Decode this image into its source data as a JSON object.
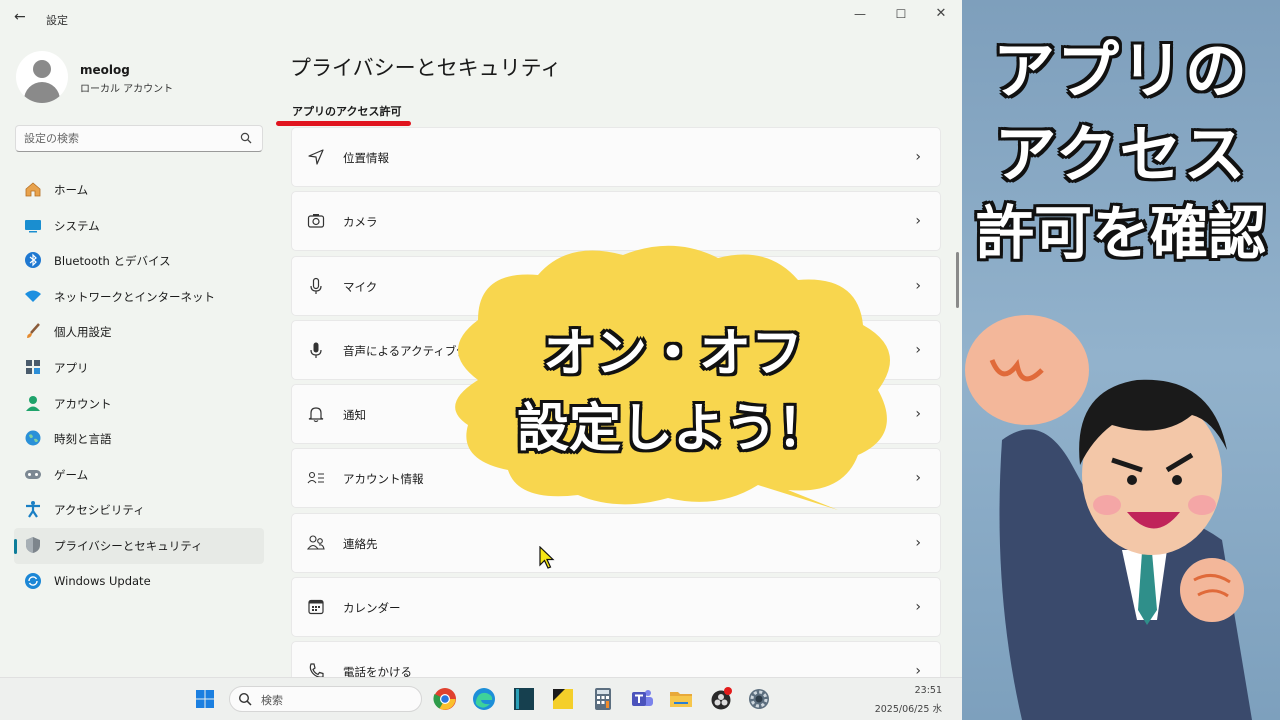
{
  "window": {
    "title": "設定"
  },
  "profile": {
    "name": "meolog",
    "account_type": "ローカル アカウント"
  },
  "search": {
    "placeholder": "設定の検索"
  },
  "sidebar": {
    "items": [
      {
        "label": "ホーム",
        "icon": "home-icon"
      },
      {
        "label": "システム",
        "icon": "system-icon"
      },
      {
        "label": "Bluetooth とデバイス",
        "icon": "bluetooth-icon"
      },
      {
        "label": "ネットワークとインターネット",
        "icon": "network-icon"
      },
      {
        "label": "個人用設定",
        "icon": "brush-icon"
      },
      {
        "label": "アプリ",
        "icon": "apps-icon"
      },
      {
        "label": "アカウント",
        "icon": "account-icon"
      },
      {
        "label": "時刻と言語",
        "icon": "globe-icon"
      },
      {
        "label": "ゲーム",
        "icon": "gamepad-icon"
      },
      {
        "label": "アクセシビリティ",
        "icon": "accessibility-icon"
      },
      {
        "label": "プライバシーとセキュリティ",
        "icon": "shield-icon",
        "selected": true
      },
      {
        "label": "Windows Update",
        "icon": "update-icon"
      }
    ]
  },
  "main": {
    "title": "プライバシーとセキュリティ",
    "section": "アプリのアクセス許可",
    "rows": [
      {
        "label": "位置情報",
        "icon": "location-icon"
      },
      {
        "label": "カメラ",
        "icon": "camera-icon"
      },
      {
        "label": "マイク",
        "icon": "microphone-icon"
      },
      {
        "label": "音声によるアクティブ化",
        "icon": "voice-icon"
      },
      {
        "label": "通知",
        "icon": "bell-icon"
      },
      {
        "label": "アカウント情報",
        "icon": "account-info-icon"
      },
      {
        "label": "連絡先",
        "icon": "contacts-icon"
      },
      {
        "label": "カレンダー",
        "icon": "calendar-icon"
      },
      {
        "label": "電話をかける",
        "icon": "phone-icon"
      }
    ],
    "chevron": "›"
  },
  "overlay": {
    "bubble_line1": "オン・オフ",
    "bubble_line2": "設定しよう！",
    "side_line1": "アプリの",
    "side_line2": "アクセス",
    "side_line3": "許可を確認"
  },
  "taskbar": {
    "search_placeholder": "検索",
    "time": "23:51",
    "date": "2025/06/25 水",
    "apps": [
      "chrome-icon",
      "edge-icon",
      "notebook-icon",
      "sticky-notes-icon",
      "calculator-icon",
      "teams-icon",
      "file-explorer-icon",
      "obs-icon",
      "settings-icon"
    ]
  },
  "colors": {
    "accent": "#0e7d9a",
    "bubble": "#f8d64e",
    "underline": "#e0141e"
  }
}
